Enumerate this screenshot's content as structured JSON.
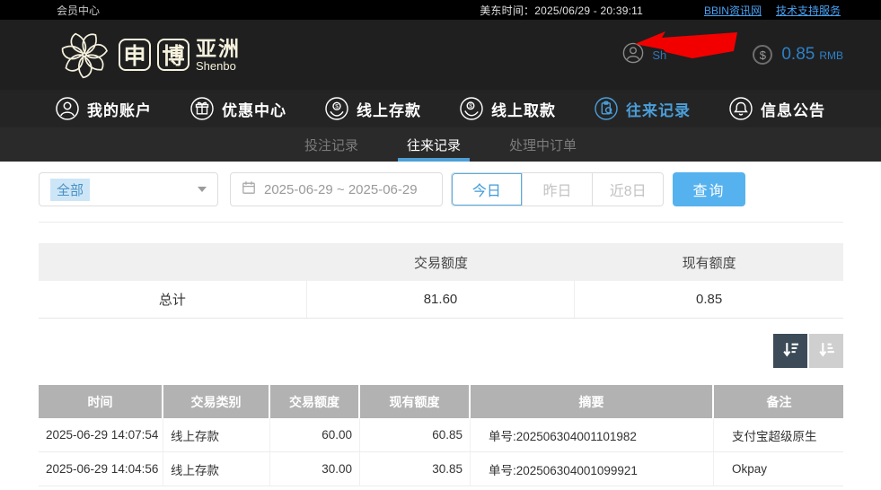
{
  "topbar": {
    "member_center": "会员中心",
    "time": "美东时间：2025/06/29 - 20:39:11",
    "links": [
      {
        "label": "BBIN资讯网"
      },
      {
        "label": "技术支持服务"
      }
    ]
  },
  "header": {
    "logo": {
      "char1": "申",
      "char2": "博",
      "region": "亚洲",
      "sub": "Shenbo"
    },
    "username_visible": "Sh",
    "balance": {
      "amount": "0.85",
      "currency": "RMB"
    }
  },
  "nav": {
    "items": [
      {
        "label": "我的账户",
        "icon": "user-icon",
        "active": false
      },
      {
        "label": "优惠中心",
        "icon": "gift-icon",
        "active": false
      },
      {
        "label": "线上存款",
        "icon": "deposit-icon",
        "active": false
      },
      {
        "label": "线上取款",
        "icon": "withdraw-icon",
        "active": false
      },
      {
        "label": "往来记录",
        "icon": "records-icon",
        "active": true
      },
      {
        "label": "信息公告",
        "icon": "bell-icon",
        "active": false
      }
    ]
  },
  "subnav": {
    "tabs": [
      {
        "label": "投注记录",
        "active": false
      },
      {
        "label": "往来记录",
        "active": true
      },
      {
        "label": "处理中订单",
        "active": false
      }
    ]
  },
  "filters": {
    "dropdown_selected": "全部",
    "date_range": "2025-06-29 ~ 2025-06-29",
    "quick": [
      {
        "label": "今日",
        "active": true
      },
      {
        "label": "昨日",
        "active": false
      },
      {
        "label": "近8日",
        "active": false
      }
    ],
    "search_label": "查询"
  },
  "summary": {
    "headers": [
      "",
      "交易额度",
      "现有额度"
    ],
    "row_label": "总计",
    "transaction_total": "81.60",
    "balance_total": "0.85"
  },
  "records": {
    "headers": [
      "时间",
      "交易类别",
      "交易额度",
      "现有额度",
      "摘要",
      "备注"
    ],
    "rows": [
      [
        "2025-06-29 14:07:54",
        "线上存款",
        "60.00",
        "60.85",
        "单号:202506304001101982",
        "支付宝超级原生"
      ],
      [
        "2025-06-29 14:04:56",
        "线上存款",
        "30.00",
        "30.85",
        "单号:202506304001099921",
        "Okpay"
      ]
    ]
  },
  "colors": {
    "accent_blue": "#4a9ed9",
    "button_blue": "#55b2ef",
    "link_blue": "#47a0f1",
    "balance_blue": "#2d81c8",
    "table_header_gray": "#b2b2b2",
    "sort_dark": "#3c4b57",
    "annotation_red": "#f20000",
    "logo_cream": "#f5f1dd"
  }
}
